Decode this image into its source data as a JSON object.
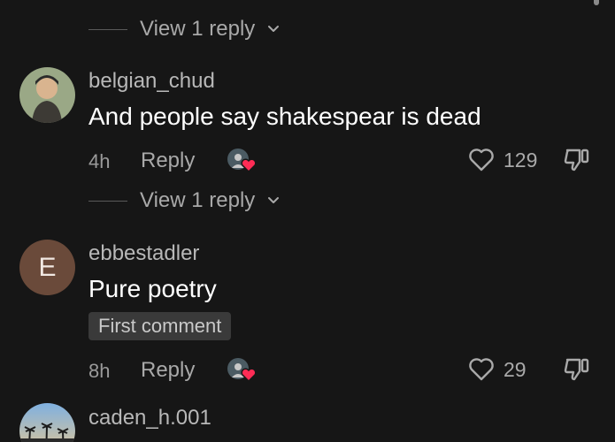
{
  "thread": {
    "view_reply_label_top": "View 1 reply",
    "view_reply_label_2": "View 1 reply"
  },
  "comments": [
    {
      "username": "belgian_chud",
      "text": "And people say shakespear is dead",
      "time": "4h",
      "reply_label": "Reply",
      "likes": "129"
    },
    {
      "username": "ebbestadler",
      "avatar_initial": "E",
      "text": "Pure poetry",
      "badge": "First comment",
      "time": "8h",
      "reply_label": "Reply",
      "likes": "29"
    },
    {
      "username": "caden_h.001"
    }
  ],
  "icons": {
    "chevron": "chevron-down-icon",
    "like": "heart-outline-icon",
    "dislike": "thumbs-down-icon",
    "creator_liked": "creator-liked-icon"
  },
  "colors": {
    "background": "#161616",
    "heart_badge": "#fe2c55",
    "avatar_initial_bg": "#6a4a3a"
  }
}
